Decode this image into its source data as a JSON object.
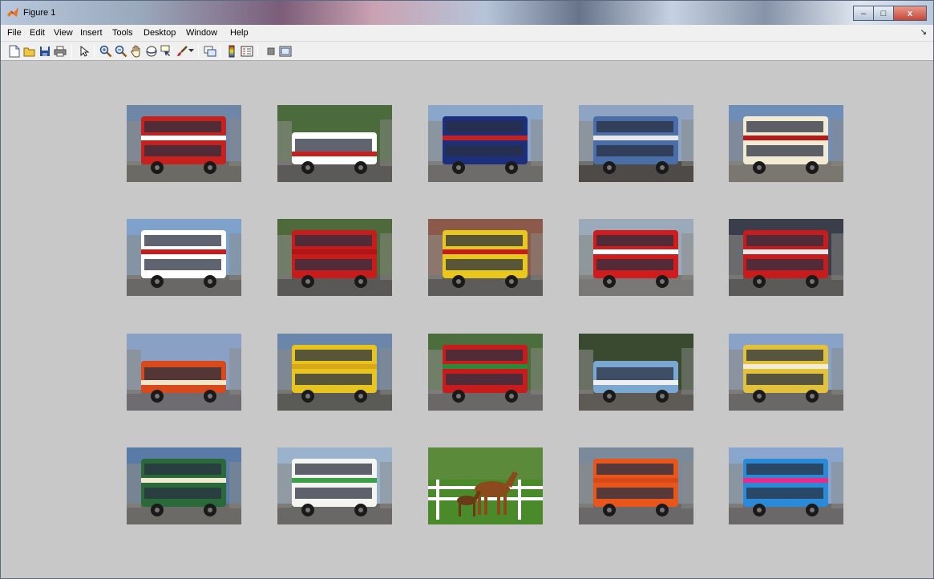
{
  "window": {
    "title": "Figure 1",
    "minimize_label": "–",
    "maximize_label": "□",
    "close_label": "x"
  },
  "menu": {
    "items": [
      "File",
      "Edit",
      "View",
      "Insert",
      "Tools",
      "Desktop",
      "Window",
      "Help"
    ],
    "dock_arrow": "↘"
  },
  "toolbar": {
    "buttons": [
      "new-figure-icon",
      "open-file-icon",
      "save-icon",
      "print-icon",
      "edit-plot-icon",
      "zoom-in-icon",
      "zoom-out-icon",
      "pan-icon",
      "rotate-3d-icon",
      "data-cursor-icon",
      "brush-icon",
      "brush-dropdown-icon",
      "link-plot-icon",
      "insert-colorbar-icon",
      "insert-legend-icon",
      "hide-plot-tools-icon",
      "show-plot-tools-icon"
    ]
  },
  "gallery": {
    "images": [
      {
        "name": "red-double-decker-city-street",
        "sky": "#6e86a8",
        "ground": "#6c6a64",
        "body": "#c8201c",
        "stripe": "#ffffff",
        "deck": 2
      },
      {
        "name": "red-white-minibus-trees",
        "sky": "#4b6b3c",
        "ground": "#5c5a58",
        "body": "#ffffff",
        "stripe": "#c8201c",
        "deck": 1
      },
      {
        "name": "sightseeing-tours-union-jack-bus",
        "sky": "#8aa6c8",
        "ground": "#6e6c6a",
        "body": "#1c2f7c",
        "stripe": "#c8201c",
        "deck": 2
      },
      {
        "name": "blue-white-double-decker",
        "sky": "#8ea4c2",
        "ground": "#4e4a48",
        "body": "#4a6ea8",
        "stripe": "#e8e8e8",
        "deck": 2
      },
      {
        "name": "red-cream-double-decker",
        "sky": "#6e8db8",
        "ground": "#7a7670",
        "body": "#f2ead2",
        "stripe": "#b81818",
        "deck": 2
      },
      {
        "name": "red-white-branded-double-decker",
        "sky": "#7ea2cc",
        "ground": "#6a6866",
        "body": "#ffffff",
        "stripe": "#c81c1c",
        "deck": 2
      },
      {
        "name": "red-double-decker-trees",
        "sky": "#4e6a3a",
        "ground": "#5a5856",
        "body": "#c81c1c",
        "stripe": "#b01414",
        "deck": 2
      },
      {
        "name": "yellow-red-double-decker",
        "sky": "#8c5a4a",
        "ground": "#5e5c5a",
        "body": "#e8c81c",
        "stripe": "#c81c1c",
        "deck": 2
      },
      {
        "name": "red-white-routemaster",
        "sky": "#9aaabb",
        "ground": "#7a7876",
        "body": "#d01c1c",
        "stripe": "#ffffff",
        "deck": 2
      },
      {
        "name": "red-double-decker-night",
        "sky": "#3a3e4a",
        "ground": "#5c5a58",
        "body": "#c81c1c",
        "stripe": "#e8e8e8",
        "deck": 2
      },
      {
        "name": "red-orange-coach",
        "sky": "#8aa0c4",
        "ground": "#6e6c70",
        "body": "#d84a1c",
        "stripe": "#f2e6c8",
        "deck": 1
      },
      {
        "name": "yellow-double-decker",
        "sky": "#6a86aa",
        "ground": "#5a5a56",
        "body": "#e8c420",
        "stripe": "#d8a818",
        "deck": 2
      },
      {
        "name": "red-green-advertising-double-decker",
        "sky": "#4c6e3c",
        "ground": "#6a6866",
        "body": "#c81c1c",
        "stripe": "#2a8a3a",
        "deck": 2
      },
      {
        "name": "light-blue-single-decker",
        "sky": "#3a4a30",
        "ground": "#5e5a56",
        "body": "#7aa8d0",
        "stripe": "#f0f0f0",
        "deck": 1
      },
      {
        "name": "yellow-cream-double-decker",
        "sky": "#88a2c8",
        "ground": "#6a6866",
        "body": "#e2c23c",
        "stripe": "#f2ecd0",
        "deck": 2
      },
      {
        "name": "green-cream-vintage-bus",
        "sky": "#5a7aa8",
        "ground": "#6c6a66",
        "body": "#2a6a3a",
        "stripe": "#f0ead2",
        "deck": 2
      },
      {
        "name": "white-green-double-decker",
        "sky": "#9ab2cc",
        "ground": "#6a6866",
        "body": "#f4f4f0",
        "stripe": "#3aa04a",
        "deck": 2
      },
      {
        "name": "horse-and-foal-field",
        "sky": "#5a8a3a",
        "ground": "#4a8a2a",
        "body": "#8a4a1c",
        "stripe": "#ffffff",
        "deck": 0
      },
      {
        "name": "orange-double-decker",
        "sky": "#7a8a9a",
        "ground": "#6a6868",
        "body": "#e8561c",
        "stripe": "#d84818",
        "deck": 2
      },
      {
        "name": "workforce-colorful-double-decker",
        "sky": "#8aa6cc",
        "ground": "#6a6868",
        "body": "#2a8ad8",
        "stripe": "#e82a8a",
        "deck": 2
      }
    ]
  },
  "colors": {
    "figure_background": "#c8c8c8",
    "menu_background": "#f0f0f0"
  }
}
